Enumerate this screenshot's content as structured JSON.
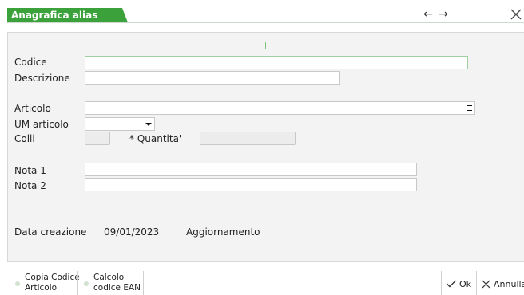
{
  "window": {
    "title": "Anagrafica alias",
    "title_color": "#3ba13b",
    "nav_back": "←",
    "nav_forward": "→"
  },
  "form": {
    "codice": {
      "label": "Codice",
      "value": ""
    },
    "descrizione": {
      "label": "Descrizione",
      "value": ""
    },
    "articolo": {
      "label": "Articolo",
      "value": ""
    },
    "um_articolo": {
      "label": "UM articolo",
      "value": ""
    },
    "colli": {
      "label": "Colli",
      "value": ""
    },
    "quantita": {
      "label": "* Quantita'",
      "value": ""
    },
    "nota1": {
      "label": "Nota 1",
      "value": ""
    },
    "nota2": {
      "label": "Nota 2",
      "value": ""
    },
    "data_creazione": {
      "label": "Data creazione",
      "value": "09/01/2023"
    },
    "aggiornamento": {
      "label": "Aggiornamento",
      "value": ""
    }
  },
  "toolbar": {
    "copia_line1": "Copia Codice",
    "copia_line2": "Articolo",
    "calcolo_line1": "Calcolo",
    "calcolo_line2": "codice EAN",
    "ok_label": "Ok",
    "annulla_label": "Annulla"
  },
  "colors": {
    "accent_green": "#3ba13b",
    "focus_border": "#9fd19f",
    "panel_bg": "#f3f3f3"
  }
}
